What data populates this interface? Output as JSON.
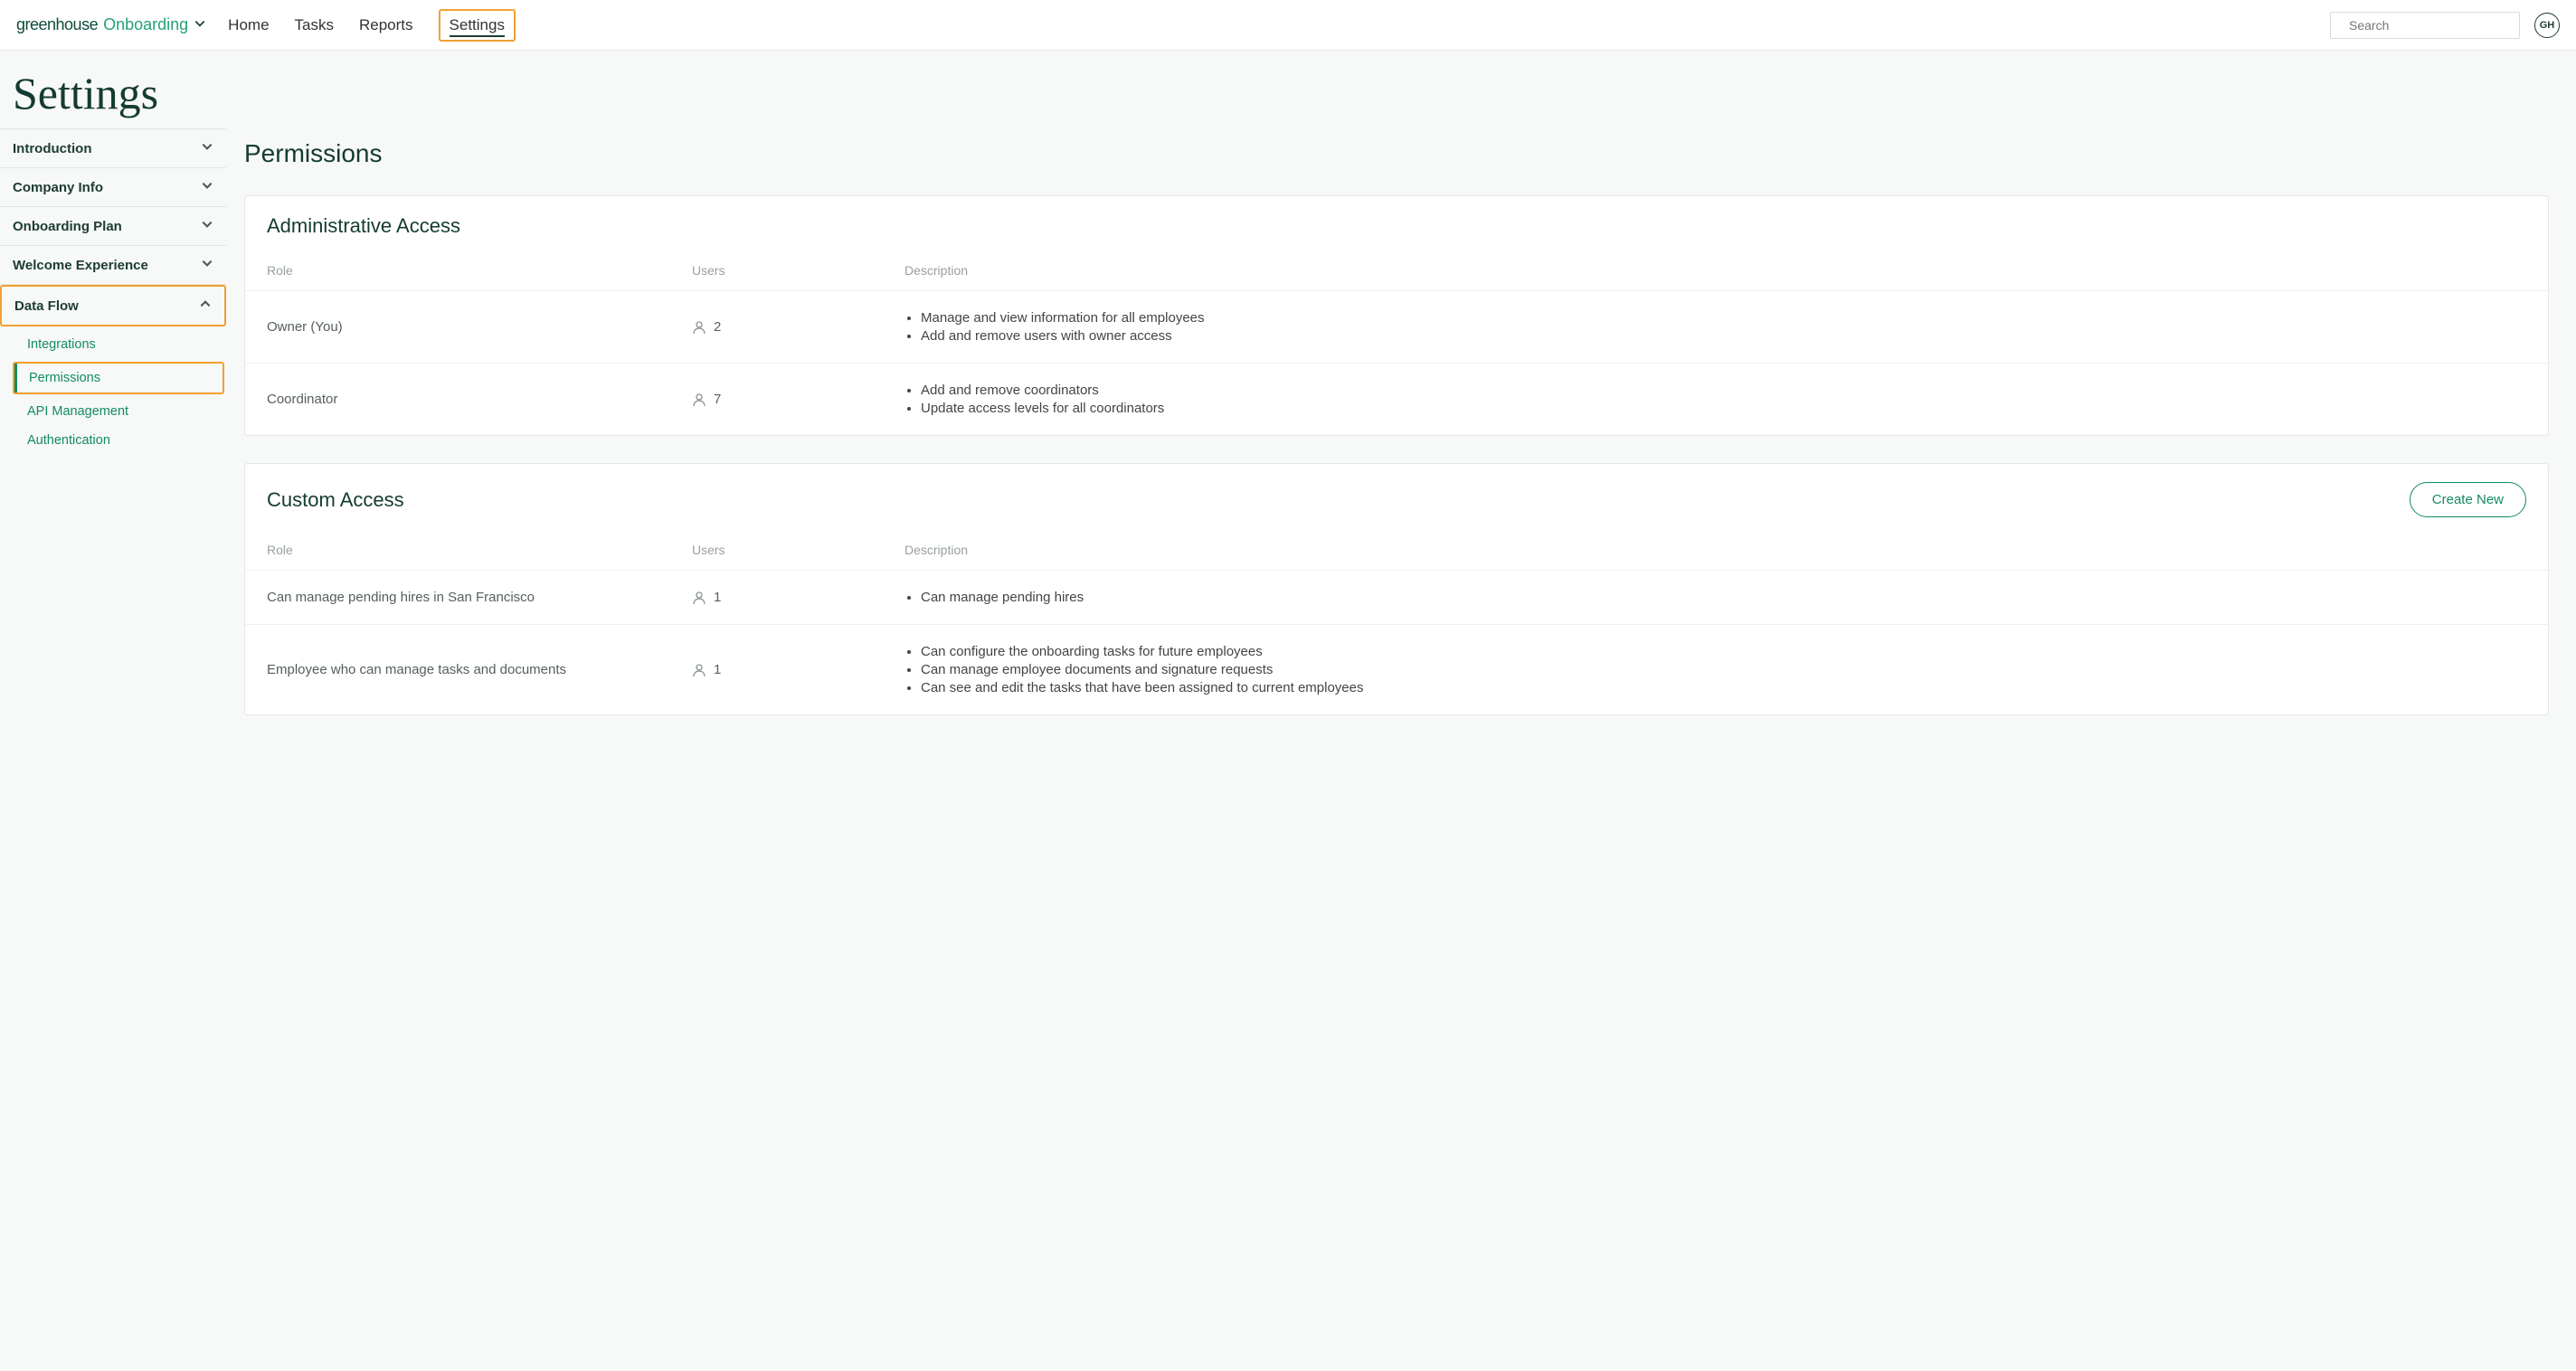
{
  "header": {
    "logo_main": "greenhouse",
    "logo_sub": "Onboarding",
    "nav": [
      "Home",
      "Tasks",
      "Reports",
      "Settings"
    ],
    "active_nav": "Settings",
    "search_placeholder": "Search",
    "avatar_initials": "GH"
  },
  "page_title": "Settings",
  "sidebar": {
    "items": [
      {
        "label": "Introduction",
        "expanded": false
      },
      {
        "label": "Company Info",
        "expanded": false
      },
      {
        "label": "Onboarding Plan",
        "expanded": false
      },
      {
        "label": "Welcome Experience",
        "expanded": false
      },
      {
        "label": "Data Flow",
        "expanded": true,
        "highlighted": true
      }
    ],
    "sub_items": [
      {
        "label": "Integrations",
        "active": false
      },
      {
        "label": "Permissions",
        "active": true,
        "highlighted": true
      },
      {
        "label": "API Management",
        "active": false
      },
      {
        "label": "Authentication",
        "active": false
      }
    ]
  },
  "main": {
    "title": "Permissions",
    "admin_panel": {
      "title": "Administrative Access",
      "columns": {
        "role": "Role",
        "users": "Users",
        "desc": "Description"
      },
      "rows": [
        {
          "role": "Owner (You)",
          "users": "2",
          "desc": [
            "Manage and view information for all employees",
            "Add and remove users with owner access"
          ]
        },
        {
          "role": "Coordinator",
          "users": "7",
          "desc": [
            "Add and remove coordinators",
            "Update access levels for all coordinators"
          ]
        }
      ]
    },
    "custom_panel": {
      "title": "Custom Access",
      "create_label": "Create New",
      "columns": {
        "role": "Role",
        "users": "Users",
        "desc": "Description"
      },
      "rows": [
        {
          "role": "Can manage pending hires in San Francisco",
          "users": "1",
          "desc": [
            "Can manage pending hires"
          ]
        },
        {
          "role": "Employee who can manage tasks and documents",
          "users": "1",
          "desc": [
            "Can configure the onboarding tasks for future employees",
            "Can manage employee documents and signature requests",
            "Can see and edit the tasks that have been assigned to current employees"
          ]
        }
      ]
    }
  }
}
